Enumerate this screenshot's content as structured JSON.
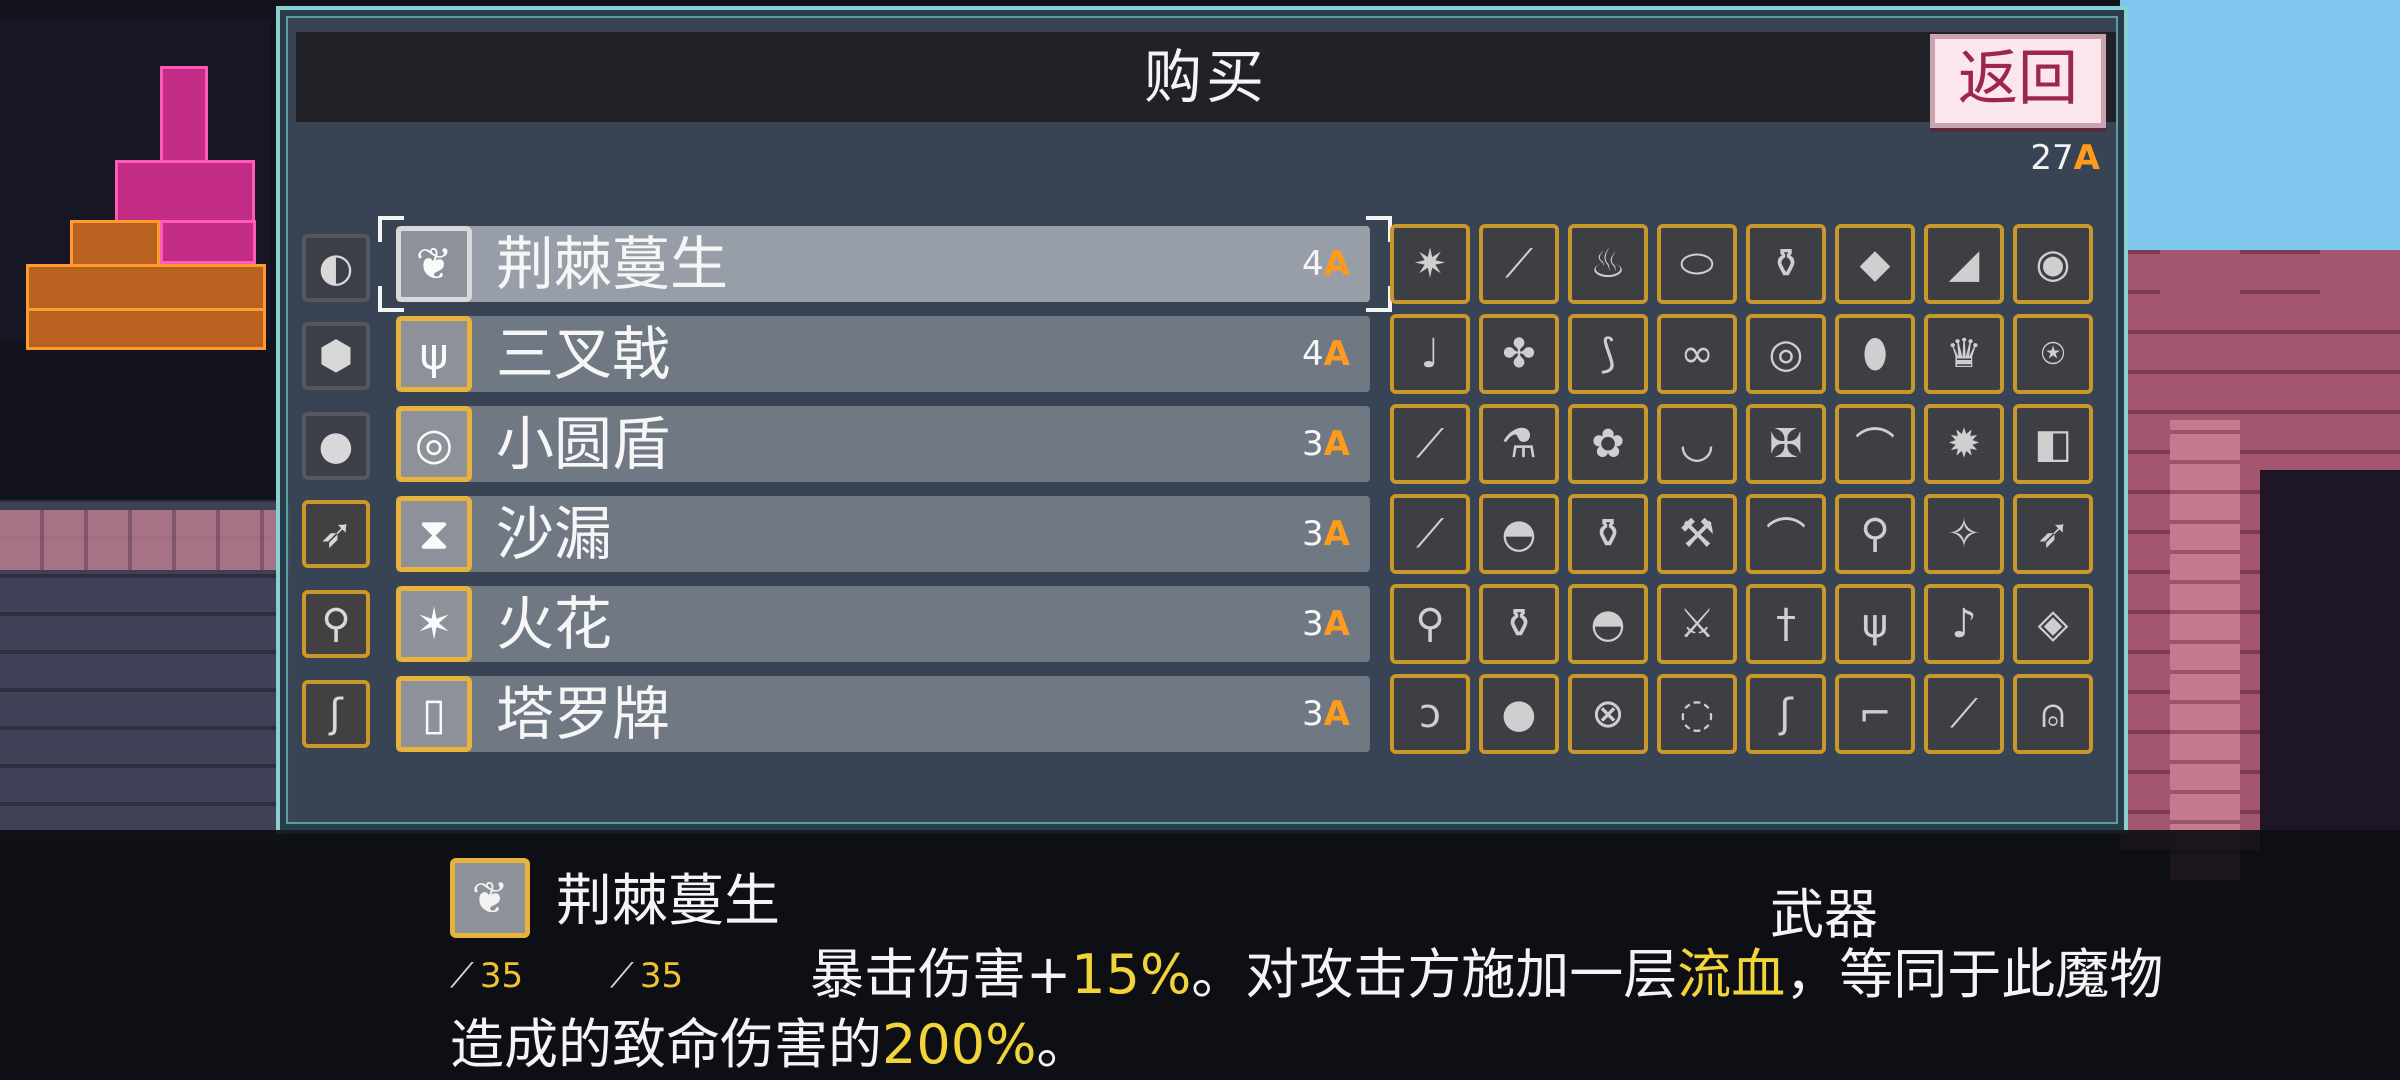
{
  "shop": {
    "title": "购买",
    "back_label": "返回",
    "currency_amount": "27",
    "currency_glyph": "A"
  },
  "items": [
    {
      "name": "荆棘蔓生",
      "price": "4",
      "icon": "thorns-icon",
      "selected": true
    },
    {
      "name": "三叉戟",
      "price": "4",
      "icon": "trident-icon"
    },
    {
      "name": "小圆盾",
      "price": "3",
      "icon": "buckler-icon"
    },
    {
      "name": "沙漏",
      "price": "3",
      "icon": "hourglass-icon"
    },
    {
      "name": "火花",
      "price": "3",
      "icon": "spark-icon"
    },
    {
      "name": "塔罗牌",
      "price": "3",
      "icon": "tarot-card-icon"
    }
  ],
  "side_icons": [
    "dark-orb-icon",
    "hex-gem-icon",
    "black-sphere-icon",
    "leaf-blade-icon",
    "torch-icon",
    "hook-icon"
  ],
  "inventory_icons": [
    [
      "thorn-claw-icon",
      "blade-icon",
      "flame-icon",
      "bread-icon",
      "flask-icon",
      "small-dot-icon",
      "shark-fin-icon",
      "round-shield-icon"
    ],
    [
      "lute-icon",
      "clover-icon",
      "scythe-icon",
      "chain-icon",
      "disc-icon",
      "droplet-icon",
      "crown-icon",
      "amulet-icon"
    ],
    [
      "club-icon",
      "potion-icon",
      "flower-icon",
      "necklace-icon",
      "cross-shield-icon",
      "curved-blade-icon",
      "gear-icon",
      "cube-icon"
    ],
    [
      "staff-icon",
      "cauldron-icon",
      "jar-icon",
      "hammer-icon",
      "bow-icon",
      "mace-icon",
      "wand-icon",
      "feather-icon"
    ],
    [
      "torch-icon",
      "vase-icon",
      "pot-icon",
      "sword-icon",
      "dagger-icon",
      "trident-icon",
      "harp-icon",
      "gem-icon"
    ],
    [
      "horn-icon",
      "bomb-icon",
      "wheel-icon",
      "orb-icon",
      "hook-icon",
      "pipe-icon",
      "spear-icon",
      "bell-icon"
    ]
  ],
  "description": {
    "name": "荆棘蔓生",
    "type": "武器",
    "scaling_left": "35",
    "scaling_right": "35",
    "text_part1": "暴击伤害+",
    "text_hl1": "15%",
    "text_part2": "。对攻击方施加一层",
    "text_hl2": "流血",
    "text_part3": "，等同于此魔物造成的致命伤害的",
    "text_hl3": "200%",
    "text_part4": "。"
  },
  "colors": {
    "accent_gold": "#e8b33a",
    "currency_orange": "#ff9b1c",
    "highlight_yellow": "#f0d43a",
    "back_button_text": "#9d2551",
    "panel_border": "#8ad0d2"
  }
}
